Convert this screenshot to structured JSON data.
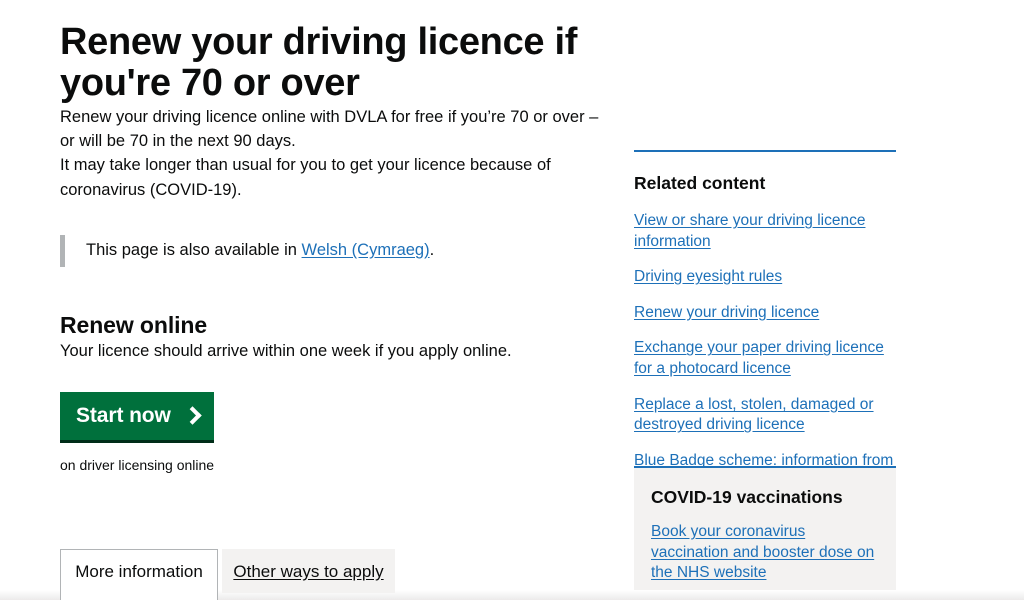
{
  "main": {
    "title": "Renew your driving licence if you're 70 or over",
    "intro_paragraph": "Renew your driving licence online with DVLA for free if you’re 70 or over – or will be 70 in the next 90 days.",
    "covid_paragraph": "It may take longer than usual for you to get your licence because of coronavirus (COVID-19).",
    "translation_prefix": "This page is also available in ",
    "translation_link": "Welsh (Cymraeg)",
    "translation_suffix": ".",
    "section_heading": "Renew online",
    "section_paragraph": "Your licence should arrive within one week if you apply online.",
    "start_button_label": "Start now",
    "start_button_icon": "chevron-right-icon",
    "start_caption": "on driver licensing online"
  },
  "tabs": [
    {
      "label": "More information",
      "active": true
    },
    {
      "label": "Other ways to apply",
      "active": false
    }
  ],
  "sidebar": {
    "related_title": "Related content",
    "related_links": [
      "View or share your driving licence information",
      "Driving eyesight rules",
      "Renew your driving licence",
      "Exchange your paper driving licence for a photocard licence",
      "Replace a lost, stolen, damaged or destroyed driving licence",
      "Blue Badge scheme: information from your council"
    ],
    "covid_title": "COVID-19 vaccinations",
    "covid_link": "Book your coronavirus vaccination and booster dose on the NHS website"
  },
  "colors": {
    "link_blue": "#1d70b8",
    "button_green": "#00703c",
    "button_green_shadow": "#002d18",
    "text_black": "#0b0c0c",
    "panel_grey": "#f3f2f1",
    "border_grey": "#b1b4b6"
  }
}
